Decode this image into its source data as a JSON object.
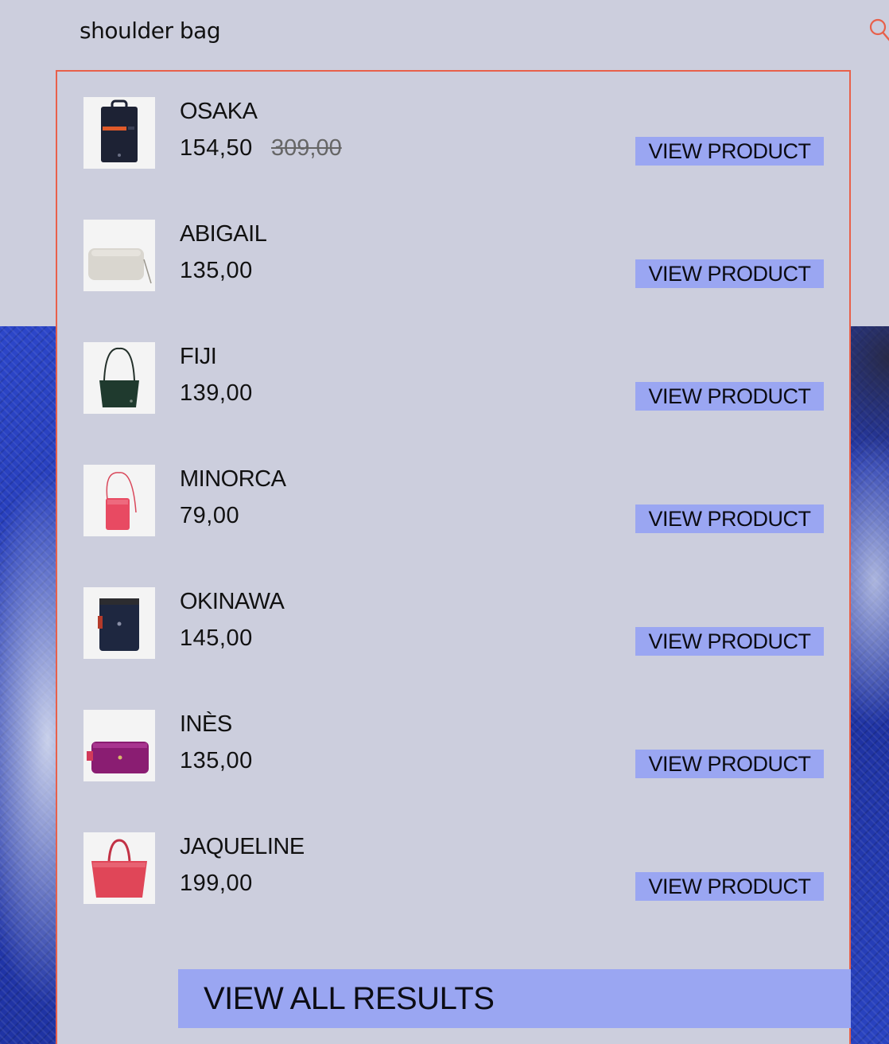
{
  "search": {
    "query": "shoulder bag",
    "icon": "search-icon",
    "accent_color": "#e8604a"
  },
  "results": [
    {
      "name": "OSAKA",
      "price": "154,50",
      "old_price": "309,00",
      "button": "VIEW PRODUCT",
      "thumb": "navy backpack"
    },
    {
      "name": "ABIGAIL",
      "price": "135,00",
      "button": "VIEW PRODUCT",
      "thumb": "light grey clutch bag"
    },
    {
      "name": "FIJI",
      "price": "139,00",
      "button": "VIEW PRODUCT",
      "thumb": "dark green shoulder bag"
    },
    {
      "name": "MINORCA",
      "price": "79,00",
      "button": "VIEW PRODUCT",
      "thumb": "red phone pouch"
    },
    {
      "name": "OKINAWA",
      "price": "145,00",
      "button": "VIEW PRODUCT",
      "thumb": "navy messenger bag"
    },
    {
      "name": "INÈS",
      "price": "135,00",
      "button": "VIEW PRODUCT",
      "thumb": "purple crossbody bag"
    },
    {
      "name": "JAQUELINE",
      "price": "199,00",
      "button": "VIEW PRODUCT",
      "thumb": "red tote bag"
    }
  ],
  "view_all_label": "VIEW ALL RESULTS",
  "colors": {
    "background": "#cccedd",
    "button": "#9aa6f2",
    "dropdown_border": "#e8604a",
    "hero_blue": "#2439b0"
  }
}
